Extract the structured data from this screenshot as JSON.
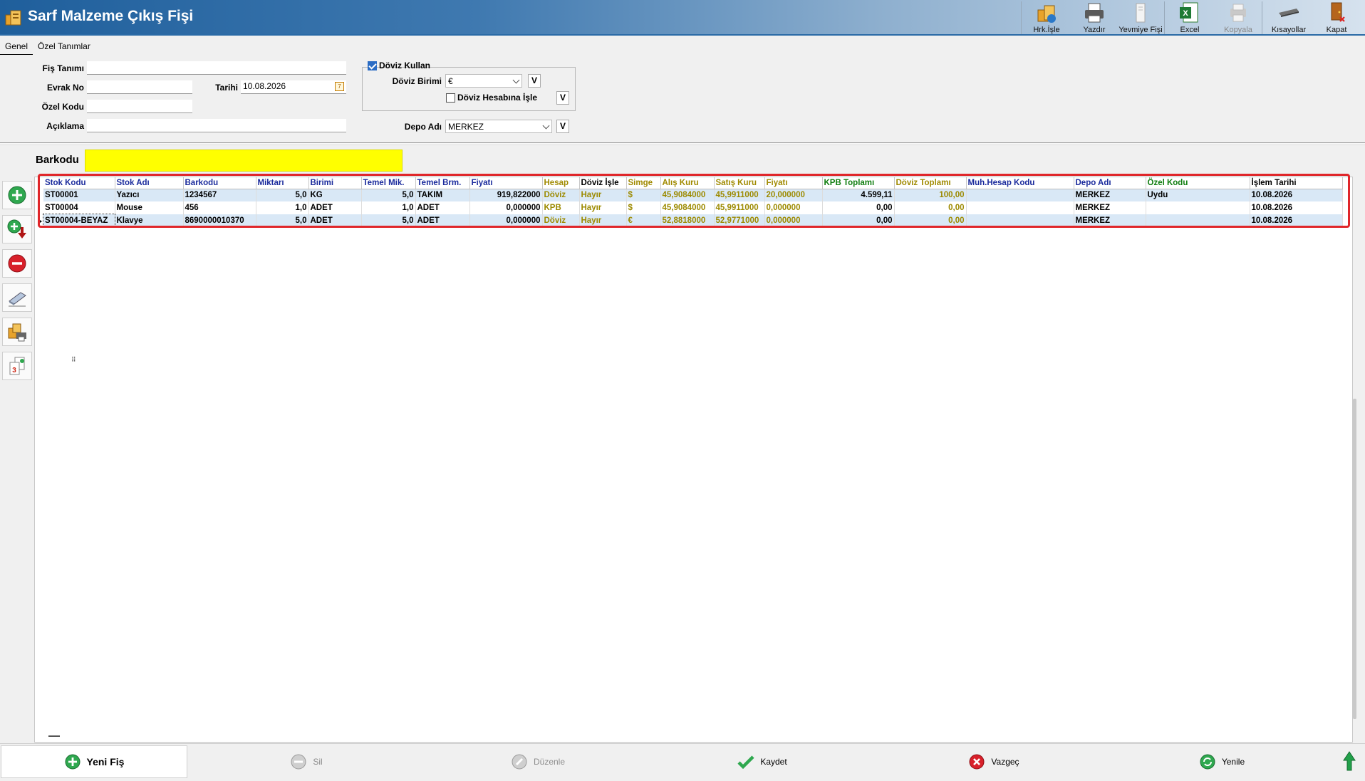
{
  "window": {
    "title": "Sarf Malzeme Çıkış Fişi"
  },
  "toolbar": [
    {
      "label": "Hrk.İşle",
      "icon": "process-icon"
    },
    {
      "label": "Yazdır",
      "icon": "printer-icon"
    },
    {
      "label": "Yevmiye Fişi",
      "icon": "journal-icon"
    },
    {
      "label": "Excel",
      "icon": "excel-icon"
    },
    {
      "label": "Kopyala",
      "icon": "copy-icon"
    },
    {
      "label": "Kısayollar",
      "icon": "keyboard-icon"
    },
    {
      "label": "Kapat",
      "icon": "close-door-icon"
    }
  ],
  "tabs": {
    "genel": "Genel",
    "ozel": "Özel Tanımlar"
  },
  "form": {
    "fis_tanimi_label": "Fiş Tanımı",
    "fis_tanimi_value": "",
    "evrak_no_label": "Evrak No",
    "evrak_no_value": "",
    "tarihi_label": "Tarihi",
    "tarihi_value": "10.08.2026",
    "ozel_kodu_label": "Özel Kodu",
    "ozel_kodu_value": "",
    "aciklama_label": "Açıklama",
    "aciklama_value": "",
    "doviz_kullan_label": "Döviz Kullan",
    "doviz_birimi_label": "Döviz Birimi",
    "doviz_birimi_value": "€",
    "doviz_hesabina_label": "Döviz Hesabına İşle",
    "depo_adi_label": "Depo Adı",
    "depo_adi_value": "MERKEZ",
    "v_button": "V"
  },
  "barkod": {
    "label": "Barkodu",
    "value": ""
  },
  "grid": {
    "headers": [
      "Stok Kodu",
      "Stok Adı",
      "Barkodu",
      "Miktarı",
      "Birimi",
      "Temel Mik.",
      "Temel Brm.",
      "Fiyatı",
      "Hesap",
      "Döviz İşle",
      "Simge",
      "Alış Kuru",
      "Satış Kuru",
      "Fiyatı",
      "KPB Toplamı",
      "Döviz Toplamı",
      "Muh.Hesap Kodu",
      "Depo Adı",
      "Özel Kodu",
      "İşlem Tarihi"
    ],
    "rows": [
      [
        "ST00001",
        "Yazıcı",
        "1234567",
        "5,0",
        "KG",
        "5,0",
        "TAKIM",
        "919,822000",
        "Döviz",
        "Hayır",
        "$",
        "45,9084000",
        "45,9911000",
        "20,000000",
        "4.599,11",
        "100,00",
        "",
        "MERKEZ",
        "Uydu",
        "10.08.2026"
      ],
      [
        "ST00004",
        "Mouse",
        "456",
        "1,0",
        "ADET",
        "1,0",
        "ADET",
        "0,000000",
        "KPB",
        "Hayır",
        "$",
        "45,9084000",
        "45,9911000",
        "0,000000",
        "0,00",
        "0,00",
        "",
        "MERKEZ",
        "",
        "10.08.2026"
      ],
      [
        "ST00004-BEYAZ",
        "Klavye",
        "8690000010370",
        "5,0",
        "ADET",
        "5,0",
        "ADET",
        "0,000000",
        "Döviz",
        "Hayır",
        "€",
        "52,8818000",
        "52,9771000",
        "0,000000",
        "0,00",
        "0,00",
        "",
        "MERKEZ",
        "",
        "10.08.2026"
      ]
    ]
  },
  "bottom": {
    "yeni_fis": "Yeni Fiş",
    "sil": "Sil",
    "duzenle": "Düzenle",
    "kaydet": "Kaydet",
    "vazgec": "Vazgeç",
    "yenile": "Yenile"
  }
}
